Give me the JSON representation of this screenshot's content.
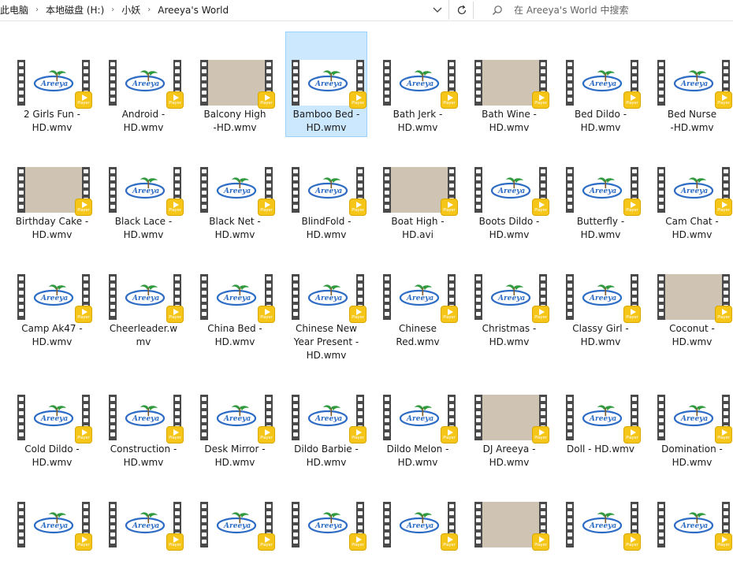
{
  "address_bar": {
    "breadcrumbs": [
      "此电脑",
      "本地磁盘 (H:)",
      "小妖",
      "Areeya's World"
    ]
  },
  "search": {
    "placeholder": "在 Areeya's World 中搜索"
  },
  "icons": {
    "chevron": "chevron-right-icon",
    "dropdown": "chevron-down-icon",
    "refresh": "refresh-icon",
    "search": "search-icon",
    "badge": "player-badge-icon"
  },
  "colors": {
    "selection": "#cce8ff",
    "selection_border": "#99d1ff",
    "badge": "#f5c518",
    "filmstrip": "#4a4a4a"
  },
  "badge_text": "Player",
  "files": [
    {
      "lines": [
        "2 Girls Fun -",
        "HD.wmv"
      ]
    },
    {
      "lines": [
        "Android -",
        "HD.wmv"
      ]
    },
    {
      "lines": [
        "Balcony High",
        "-HD.wmv"
      ],
      "photo": true
    },
    {
      "lines": [
        "Bamboo Bed -",
        "HD.wmv"
      ],
      "selected": true
    },
    {
      "lines": [
        "Bath Jerk -",
        "HD.wmv"
      ]
    },
    {
      "lines": [
        "Bath Wine -",
        "HD.wmv"
      ],
      "photo": true
    },
    {
      "lines": [
        "Bed Dildo -",
        "HD.wmv"
      ]
    },
    {
      "lines": [
        "Bed Nurse",
        "-HD.wmv"
      ]
    },
    {
      "lines": [
        "Birthday Cake -",
        "HD.wmv"
      ],
      "photo": true
    },
    {
      "lines": [
        "Black Lace -",
        "HD.wmv"
      ]
    },
    {
      "lines": [
        "Black Net -",
        "HD.wmv"
      ]
    },
    {
      "lines": [
        "BlindFold -",
        "HD.wmv"
      ]
    },
    {
      "lines": [
        "Boat High -",
        "HD.avi"
      ],
      "photo": true
    },
    {
      "lines": [
        "Boots Dildo -",
        "HD.wmv"
      ]
    },
    {
      "lines": [
        "Butterfly -",
        "HD.wmv"
      ]
    },
    {
      "lines": [
        "Cam Chat -",
        "HD.wmv"
      ]
    },
    {
      "lines": [
        "Camp Ak47 -",
        "HD.wmv"
      ]
    },
    {
      "lines": [
        "Cheerleader.w",
        "mv"
      ]
    },
    {
      "lines": [
        "China Bed -",
        "HD.wmv"
      ]
    },
    {
      "lines": [
        "Chinese New",
        "Year Present -",
        "HD.wmv"
      ]
    },
    {
      "lines": [
        "Chinese",
        "Red.wmv"
      ]
    },
    {
      "lines": [
        "Christmas -",
        "HD.wmv"
      ]
    },
    {
      "lines": [
        "Classy Girl -",
        "HD.wmv"
      ]
    },
    {
      "lines": [
        "Coconut -",
        "HD.wmv"
      ],
      "photo": true
    },
    {
      "lines": [
        "Cold Dildo -",
        "HD.wmv"
      ]
    },
    {
      "lines": [
        "Construction -",
        "HD.wmv"
      ]
    },
    {
      "lines": [
        "Desk Mirror  -",
        "HD.wmv"
      ]
    },
    {
      "lines": [
        "Dildo Barbie -",
        "HD.wmv"
      ]
    },
    {
      "lines": [
        "Dildo Melon -",
        "HD.wmv"
      ]
    },
    {
      "lines": [
        "DJ Areeya -",
        "HD.wmv"
      ],
      "photo": true
    },
    {
      "lines": [
        "Doll - HD.wmv"
      ]
    },
    {
      "lines": [
        "Domination -",
        "HD.wmv"
      ]
    },
    {
      "lines": []
    },
    {
      "lines": []
    },
    {
      "lines": []
    },
    {
      "lines": []
    },
    {
      "lines": []
    },
    {
      "lines": [],
      "photo": true
    },
    {
      "lines": []
    },
    {
      "lines": []
    }
  ]
}
